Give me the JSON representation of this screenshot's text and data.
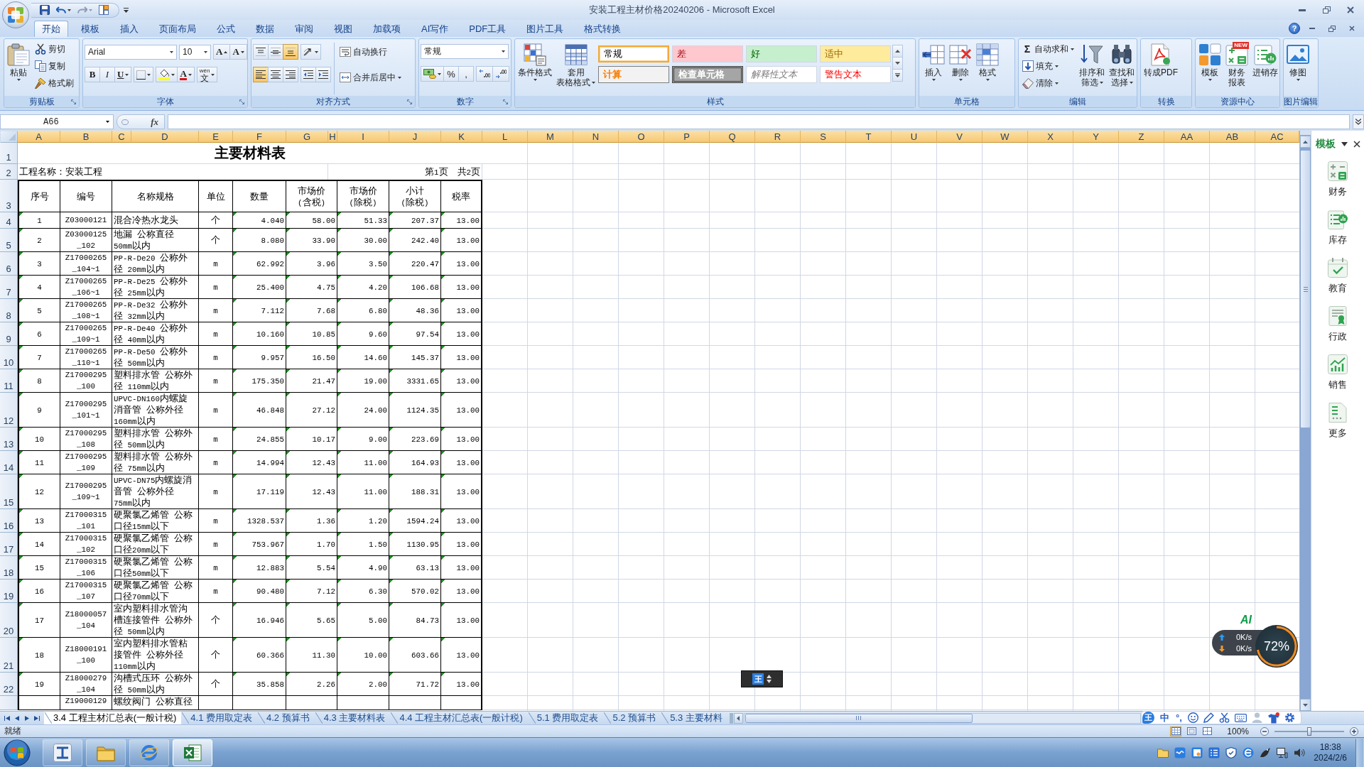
{
  "window": {
    "title": "安装工程主材价格20240206 - Microsoft Excel",
    "help_symbol": "?"
  },
  "ribbon_tabs": [
    {
      "label": "开始",
      "selected": true
    },
    {
      "label": "模板",
      "selected": false
    },
    {
      "label": "插入",
      "selected": false
    },
    {
      "label": "页面布局",
      "selected": false
    },
    {
      "label": "公式",
      "selected": false
    },
    {
      "label": "数据",
      "selected": false
    },
    {
      "label": "审阅",
      "selected": false
    },
    {
      "label": "视图",
      "selected": false
    },
    {
      "label": "加载项",
      "selected": false
    },
    {
      "label": "AI写作",
      "selected": false
    },
    {
      "label": "PDF工具",
      "selected": false
    },
    {
      "label": "图片工具",
      "selected": false
    },
    {
      "label": "格式转换",
      "selected": false
    }
  ],
  "clipboard": {
    "label": "剪贴板",
    "paste": "粘贴",
    "commands": [
      {
        "kind": "cut",
        "label": "剪切"
      },
      {
        "kind": "copy",
        "label": "复制"
      },
      {
        "kind": "painter",
        "label": "格式刷"
      }
    ]
  },
  "font": {
    "label": "字体",
    "name": "Arial",
    "size": "10",
    "grow": "A",
    "shrink": "A",
    "styles": [
      {
        "kind": "bold",
        "char": "B"
      },
      {
        "kind": "italic",
        "char": "I"
      },
      {
        "kind": "underline",
        "char": "U"
      }
    ],
    "font_color": "A",
    "phonetic_ruby": "wén",
    "phonetic_char": "文"
  },
  "alignment": {
    "label": "对齐方式",
    "vertical": [
      {
        "kind": "top",
        "selected": false
      },
      {
        "kind": "middle",
        "selected": false
      },
      {
        "kind": "bottom",
        "selected": true
      }
    ],
    "horizontal": [
      {
        "kind": "left",
        "selected": true
      },
      {
        "kind": "center",
        "selected": false
      },
      {
        "kind": "right",
        "selected": false
      }
    ],
    "wrap": "自动换行",
    "merge": "合并后居中"
  },
  "number": {
    "label": "数字",
    "format": "常规",
    "percent": "%",
    "comma": ","
  },
  "styles": {
    "label": "样式",
    "commands": [
      {
        "kind": "conditional",
        "label": "条件格式",
        "dropdown": true
      },
      {
        "kind": "table",
        "label": [
          "套用",
          "表格格式"
        ],
        "dropdown": true
      }
    ],
    "gallery": [
      {
        "kind": "normal",
        "label": "常规",
        "selected": true
      },
      {
        "kind": "bad",
        "label": "差",
        "selected": false
      },
      {
        "kind": "good",
        "label": "好",
        "selected": false
      },
      {
        "kind": "neutral",
        "label": "适中",
        "selected": false
      },
      {
        "kind": "calc",
        "label": "计算",
        "selected": false
      },
      {
        "kind": "check",
        "label": "检查单元格",
        "selected": false
      },
      {
        "kind": "explanatory",
        "label": "解释性文本",
        "selected": false
      },
      {
        "kind": "warning",
        "label": "警告文本",
        "selected": false
      }
    ]
  },
  "cells": {
    "label": "单元格",
    "commands": [
      {
        "kind": "insert",
        "label": "插入",
        "dropdown": true
      },
      {
        "kind": "delete",
        "label": "删除",
        "dropdown": true
      },
      {
        "kind": "format",
        "label": "格式",
        "dropdown": true
      }
    ]
  },
  "editing": {
    "label": "编辑",
    "commands": [
      {
        "kind": "autosum",
        "symbol": "Σ",
        "label": "自动求和",
        "dropdown": true
      },
      {
        "kind": "fill",
        "label": "填充",
        "dropdown": true
      },
      {
        "kind": "clear",
        "label": "清除",
        "dropdown": true
      }
    ],
    "large": [
      {
        "kind": "sort",
        "label": [
          "排序和",
          "筛选"
        ],
        "dropdown": true
      },
      {
        "kind": "find",
        "label": [
          "查找和",
          "选择"
        ],
        "dropdown": true
      }
    ]
  },
  "convert": {
    "label": "转换",
    "commands": [
      {
        "kind": "pdf",
        "label": "转成PDF",
        "dropdown": false
      }
    ]
  },
  "resources": {
    "label": "资源中心",
    "commands": [
      {
        "kind": "template",
        "label": "模板",
        "dropdown": true
      },
      {
        "kind": "report",
        "label": [
          "财务",
          "报表"
        ],
        "dropdown": false,
        "badge": "NEW"
      },
      {
        "kind": "inventory",
        "label": "进销存",
        "dropdown": false
      }
    ]
  },
  "image_edit": {
    "label": "图片编辑",
    "commands": [
      {
        "kind": "retouch",
        "label": "修图",
        "dropdown": true
      }
    ]
  },
  "formula_bar": {
    "name_box": "A66",
    "function_symbol": "fx"
  },
  "sheet": {
    "column_letters": [
      "A",
      "B",
      "C",
      "D",
      "E",
      "F",
      "G",
      "H",
      "I",
      "J",
      "K",
      "L",
      "M",
      "N",
      "O",
      "P",
      "Q",
      "R",
      "S",
      "T",
      "U",
      "V",
      "W",
      "X",
      "Y",
      "Z",
      "AA",
      "AB",
      "AC"
    ],
    "header_highlight": true,
    "table": {
      "title": {
        "row": "1",
        "text": "主要材料表"
      },
      "info": {
        "row": "2",
        "project": "工程名称：安装工程",
        "page": "第1页  共2页"
      },
      "header": {
        "row": "3",
        "cells": [
          {
            "label": "序号",
            "marks": true
          },
          {
            "label": "编号",
            "marks": false
          },
          {
            "label": "名称规格",
            "marks": false
          },
          {
            "label": "单位",
            "marks": false
          },
          {
            "label": "数量",
            "marks": true
          },
          {
            "label": "市场价\n(含税)",
            "marks": true
          },
          {
            "label": "市场价\n(除税)",
            "marks": true
          },
          {
            "label": "小计\n(除税)",
            "marks": true
          },
          {
            "label": "税率",
            "marks": true
          }
        ]
      },
      "rows": [
        {
          "row": "4",
          "cells": [
            "1",
            "Z03000121",
            "混合冷热水龙头",
            "个",
            "4.040",
            "58.00",
            "51.33",
            "207.37",
            "13.00"
          ]
        },
        {
          "row": "5",
          "cells": [
            "2",
            "Z03000125_102",
            "地漏 公称直径50mm以内",
            "个",
            "8.080",
            "33.90",
            "30.00",
            "242.40",
            "13.00"
          ]
        },
        {
          "row": "6",
          "cells": [
            "3",
            "Z17000265_104~1",
            "PP-R-De20 公称外径 20mm以内",
            "m",
            "62.992",
            "3.96",
            "3.50",
            "220.47",
            "13.00"
          ]
        },
        {
          "row": "7",
          "cells": [
            "4",
            "Z17000265_106~1",
            "PP-R-De25 公称外径 25mm以内",
            "m",
            "25.400",
            "4.75",
            "4.20",
            "106.68",
            "13.00"
          ]
        },
        {
          "row": "8",
          "cells": [
            "5",
            "Z17000265_108~1",
            "PP-R-De32 公称外径 32mm以内",
            "m",
            "7.112",
            "7.68",
            "6.80",
            "48.36",
            "13.00"
          ]
        },
        {
          "row": "9",
          "cells": [
            "6",
            "Z17000265_109~1",
            "PP-R-De40 公称外径 40mm以内",
            "m",
            "10.160",
            "10.85",
            "9.60",
            "97.54",
            "13.00"
          ]
        },
        {
          "row": "10",
          "cells": [
            "7",
            "Z17000265_110~1",
            "PP-R-De50 公称外径 50mm以内",
            "m",
            "9.957",
            "16.50",
            "14.60",
            "145.37",
            "13.00"
          ]
        },
        {
          "row": "11",
          "cells": [
            "8",
            "Z17000295_100",
            "塑料排水管 公称外径 110mm以内",
            "m",
            "175.350",
            "21.47",
            "19.00",
            "3331.65",
            "13.00"
          ]
        },
        {
          "row": "12",
          "cells": [
            "9",
            "Z17000295_101~1",
            "UPVC-DN160内螺旋消音管 公称外径160mm以内",
            "m",
            "46.848",
            "27.12",
            "24.00",
            "1124.35",
            "13.00"
          ]
        },
        {
          "row": "13",
          "cells": [
            "10",
            "Z17000295_108",
            "塑料排水管 公称外径 50mm以内",
            "m",
            "24.855",
            "10.17",
            "9.00",
            "223.69",
            "13.00"
          ]
        },
        {
          "row": "14",
          "cells": [
            "11",
            "Z17000295_109",
            "塑料排水管 公称外径 75mm以内",
            "m",
            "14.994",
            "12.43",
            "11.00",
            "164.93",
            "13.00"
          ]
        },
        {
          "row": "15",
          "cells": [
            "12",
            "Z17000295_109~1",
            "UPVC-DN75内螺旋消音管 公称外径75mm以内",
            "m",
            "17.119",
            "12.43",
            "11.00",
            "188.31",
            "13.00"
          ]
        },
        {
          "row": "16",
          "cells": [
            "13",
            "Z17000315_101",
            "硬聚氯乙烯管 公称口径15mm以下",
            "m",
            "1328.537",
            "1.36",
            "1.20",
            "1594.24",
            "13.00"
          ]
        },
        {
          "row": "17",
          "cells": [
            "14",
            "Z17000315_102",
            "硬聚氯乙烯管 公称口径20mm以下",
            "m",
            "753.967",
            "1.70",
            "1.50",
            "1130.95",
            "13.00"
          ]
        },
        {
          "row": "18",
          "cells": [
            "15",
            "Z17000315_106",
            "硬聚氯乙烯管 公称口径50mm以下",
            "m",
            "12.883",
            "5.54",
            "4.90",
            "63.13",
            "13.00"
          ]
        },
        {
          "row": "19",
          "cells": [
            "16",
            "Z17000315_107",
            "硬聚氯乙烯管 公称口径70mm以下",
            "m",
            "90.480",
            "7.12",
            "6.30",
            "570.02",
            "13.00"
          ]
        },
        {
          "row": "20",
          "cells": [
            "17",
            "Z18000057_104",
            "室内塑料排水管沟槽连接管件 公称外径 50mm以内",
            "个",
            "16.946",
            "5.65",
            "5.00",
            "84.73",
            "13.00"
          ]
        },
        {
          "row": "21",
          "cells": [
            "18",
            "Z18000191_100",
            "室内塑料排水管粘接管件 公称外径110mm以内",
            "个",
            "60.366",
            "11.30",
            "10.00",
            "603.66",
            "13.00"
          ]
        },
        {
          "row": "22",
          "cells": [
            "19",
            "Z18000279_104",
            "沟槽式压环 公称外径 50mm以内",
            "个",
            "35.858",
            "2.26",
            "2.00",
            "71.72",
            "13.00"
          ]
        }
      ],
      "cut_row": {
        "code": "Z19000129",
        "name": "螺纹阀门 公称直径"
      }
    }
  },
  "right_panel": {
    "title": "模板",
    "items": [
      {
        "kind": "finance",
        "label": "财务"
      },
      {
        "kind": "inventory",
        "label": "库存"
      },
      {
        "kind": "education",
        "label": "教育"
      },
      {
        "kind": "admin",
        "label": "行政"
      },
      {
        "kind": "sales",
        "label": "销售"
      },
      {
        "kind": "more",
        "label": "更多"
      }
    ]
  },
  "sheet_tabs": [
    {
      "label": "3.4 工程主材汇总表(一般计税)",
      "selected": true
    },
    {
      "label": "4.1 费用取定表",
      "selected": false
    },
    {
      "label": "4.2 预算书",
      "selected": false
    },
    {
      "label": "4.3 主要材料表",
      "selected": false
    },
    {
      "label": "4.4 工程主材汇总表(一般计税)",
      "selected": false
    },
    {
      "label": "5.1 费用取定表",
      "selected": false
    },
    {
      "label": "5.2 预算书",
      "selected": false
    },
    {
      "label": "5.3 主要材料",
      "selected": false
    }
  ],
  "status_bar": {
    "text": "就绪",
    "views": [
      {
        "kind": "normal",
        "selected": true
      },
      {
        "kind": "layout",
        "selected": false
      },
      {
        "kind": "break",
        "selected": false
      }
    ],
    "zoom": "100%",
    "zoom_slider": {
      "level": 0.5
    }
  },
  "taskbar": {
    "apps": [
      {
        "kind": "ibeam",
        "active": false
      },
      {
        "kind": "folder",
        "active": false
      },
      {
        "kind": "browser",
        "active": false
      },
      {
        "kind": "spreadsheet",
        "active": true
      }
    ],
    "time": "18:38",
    "date": "2024/2/6"
  },
  "ime_bar": {
    "logo": "王",
    "mode": "中",
    "punctuation": "°,"
  },
  "floating_toolbar": {
    "logo": "王"
  },
  "network_widget": {
    "badge": "AI",
    "upload": "0K/s",
    "download": "0K/s",
    "reading": "72%"
  }
}
